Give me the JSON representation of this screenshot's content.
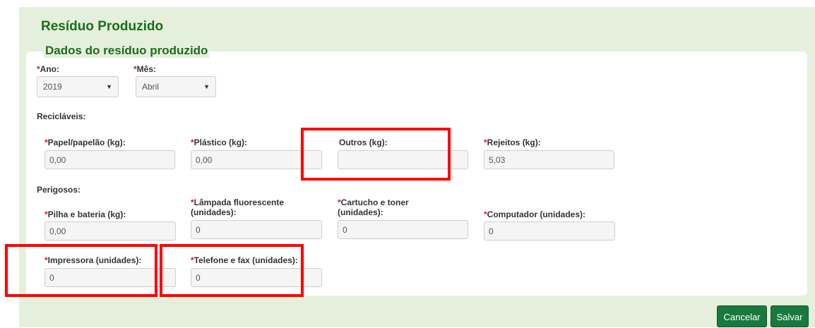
{
  "page": {
    "title": "Resíduo Produzido",
    "section_title": "Dados do resíduo produzido"
  },
  "required_marker": "*",
  "date": {
    "ano": {
      "label": "Ano:",
      "value": "2019"
    },
    "mes": {
      "label": "Mês:",
      "value": "Abril"
    }
  },
  "reciclaveis": {
    "heading": "Recicláveis:",
    "fields": [
      {
        "label": "Papel/papelão (kg):",
        "value": "0,00",
        "required": true
      },
      {
        "label": "Plástico (kg):",
        "value": "0,00",
        "required": true
      },
      {
        "label": "Outros (kg):",
        "value": "",
        "required": false
      },
      {
        "label": "Rejeitos (kg):",
        "value": "5,03",
        "required": true
      }
    ]
  },
  "perigosos": {
    "heading": "Perigosos:",
    "fields": [
      {
        "label": "Pilha e bateria (kg):",
        "value": "0,00",
        "required": true
      },
      {
        "label_line1": "Lâmpada fluorescente",
        "label_line2": "(unidades):",
        "value": "0",
        "required": true
      },
      {
        "label_line1": "Cartucho e toner",
        "label_line2": "(unidades):",
        "value": "0",
        "required": true
      },
      {
        "label": "Computador (unidades):",
        "value": "0",
        "required": true
      },
      {
        "label": "Impressora (unidades):",
        "value": "0",
        "required": true
      },
      {
        "label": "Telefone e fax (unidades):",
        "value": "0",
        "required": true
      }
    ]
  },
  "buttons": {
    "cancel": "Cancelar",
    "save": "Salvar"
  },
  "colors": {
    "panel_bg": "#e5f0dc",
    "title_green": "#1a6e1a",
    "button_green": "#197a3d",
    "required_red": "#e0101a",
    "highlight_red": "#ff0000"
  }
}
